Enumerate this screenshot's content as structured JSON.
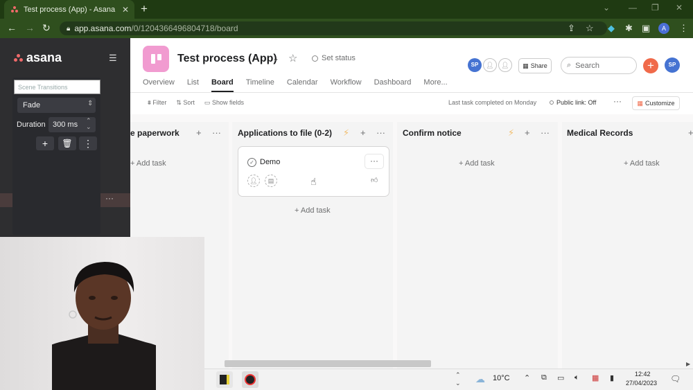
{
  "browser": {
    "tab_title": "Test process (App) - Asana",
    "tab_close": "✕",
    "new_tab": "+",
    "url_domain": "app.asana.com",
    "url_path": "/0/1204366496804718/board"
  },
  "obs": {
    "search_placeholder": "Scene Transitions",
    "transition": "Fade",
    "duration_label": "Duration",
    "duration_value": "300 ms"
  },
  "sidebar": {
    "logo_text": "asana",
    "row_more": "···"
  },
  "project": {
    "title": "Test process (App)",
    "set_status": "Set status",
    "avatar_initials": "SP",
    "share_label": "Share",
    "search_placeholder": "Search",
    "user_initials": "SP",
    "tabs": [
      "Overview",
      "List",
      "Board",
      "Timeline",
      "Calendar",
      "Workflow",
      "Dashboard",
      "More..."
    ],
    "active_tab": "Board"
  },
  "controls": {
    "filter": "Filter",
    "sort": "Sort",
    "show_fields": "Show fields",
    "last_task": "Last task completed on Monday",
    "public_link": "Public link: Off",
    "more": "···",
    "customize": "Customize"
  },
  "board": {
    "columns": [
      {
        "title": "e paperwork",
        "add_task": "+ Add task"
      },
      {
        "title": "Applications to file (0-2)",
        "add_task": "+ Add task"
      },
      {
        "title": "Confirm notice",
        "add_task": "+ Add task"
      },
      {
        "title": "Medical Records",
        "add_task": "+ Add task"
      }
    ],
    "card": {
      "name": "Demo",
      "more": "···"
    }
  },
  "taskbar": {
    "weather": "10°C",
    "time": "12:42",
    "date": "27/04/2023"
  },
  "colors": {
    "accent_orange": "#f06a4a",
    "project_pink": "#f19bd0",
    "avatar_blue": "#4573d2"
  }
}
